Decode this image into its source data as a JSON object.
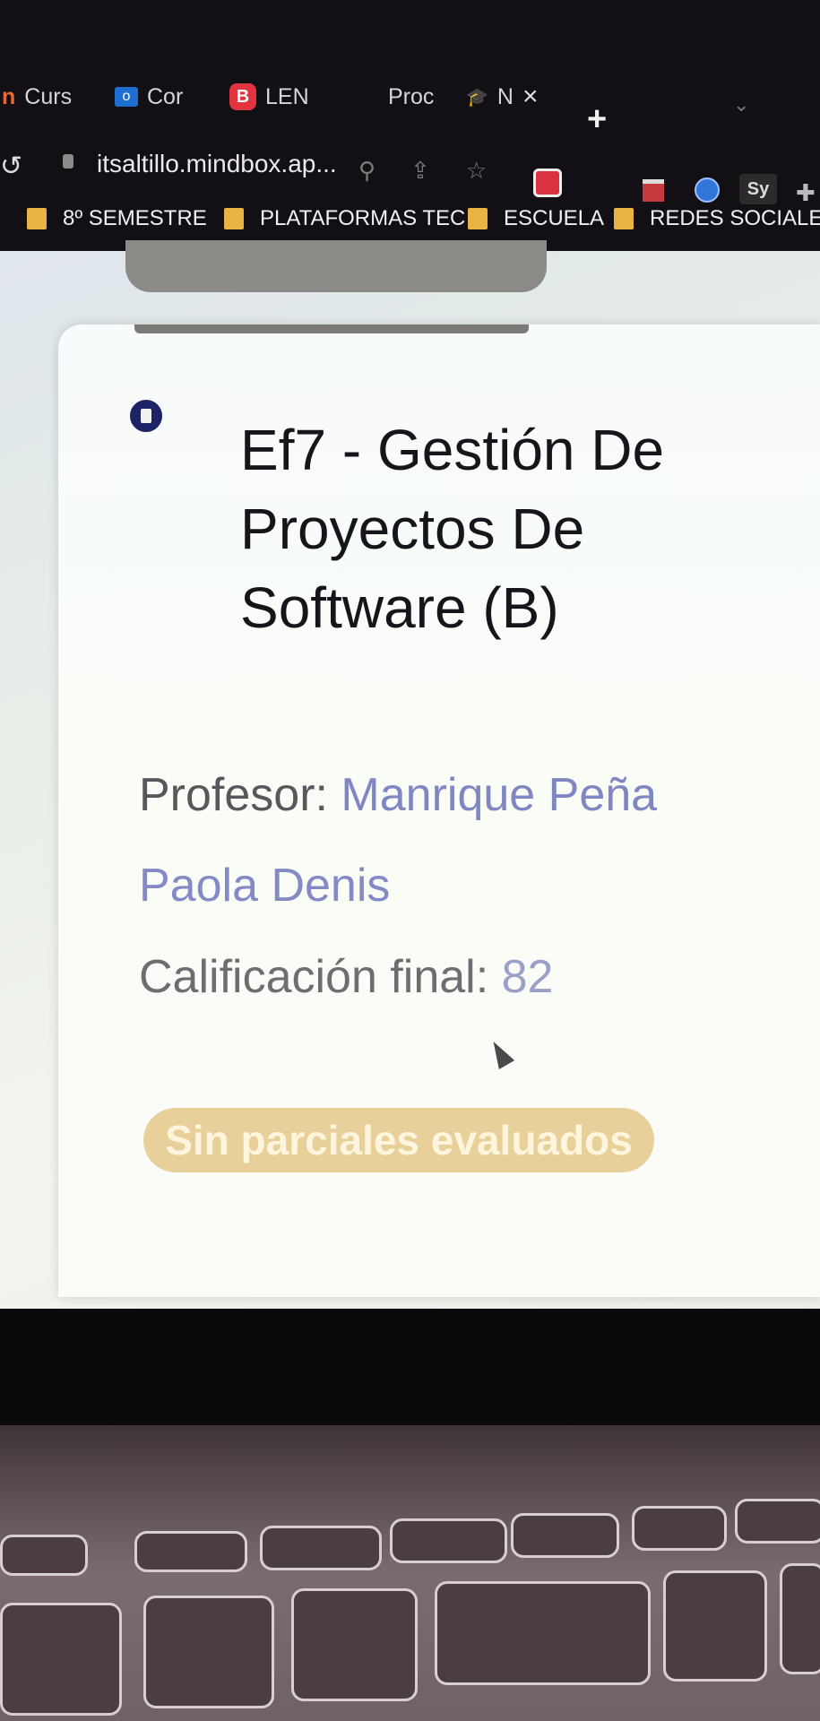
{
  "browser": {
    "tabs": [
      {
        "label": "Curs",
        "icon": "n-icon"
      },
      {
        "label": "Cor",
        "icon": "outlook-icon"
      },
      {
        "label": "LEN",
        "icon": "blogger-icon"
      },
      {
        "label": "Proc",
        "icon": "none"
      },
      {
        "label": "N",
        "icon": "graduation-cap-icon",
        "close": "×"
      }
    ],
    "new_tab": "+",
    "url": "itsaltillo.mindbox.ap...",
    "bookmarks": [
      "8º SEMESTRE",
      "PLATAFORMAS TEC",
      "ESCUELA",
      "REDES SOCIALES"
    ],
    "extensions": {
      "sy_label": "Sy"
    }
  },
  "course_card": {
    "title": "Ef7 - Gestión De Proyectos De Software (B)",
    "profesor_label": "Profesor: ",
    "profesor_name_part1": "Manrique Peña",
    "profesor_name_part2": "Paola Denis",
    "calificacion_label": "Calificación final: ",
    "calificacion_value": "82",
    "status_badge": "Sin parciales evaluados"
  },
  "colors": {
    "badge": "#e8d09a",
    "name_link": "#7f86c2",
    "title": "#15161c"
  }
}
